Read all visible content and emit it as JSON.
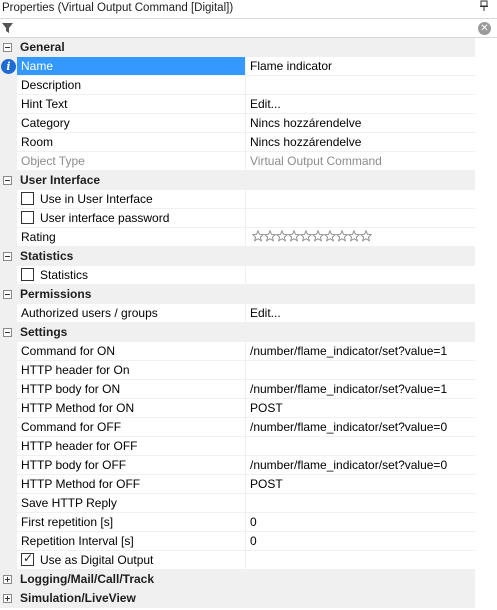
{
  "panel": {
    "title": "Properties (Virtual Output Command [Digital])",
    "pin_glyph": "📌",
    "filter_placeholder": "",
    "clear_glyph": "✕"
  },
  "rows": [
    {
      "kind": "category",
      "label": "General",
      "expanded": true
    },
    {
      "kind": "prop",
      "name": "Name",
      "value": "Flame indicator",
      "selected": true,
      "icon": "info-icon"
    },
    {
      "kind": "prop",
      "name": "Description",
      "value": ""
    },
    {
      "kind": "prop",
      "name": "Hint Text",
      "value": "Edit..."
    },
    {
      "kind": "prop",
      "name": "Category",
      "value": "Nincs hozzárendelve"
    },
    {
      "kind": "prop",
      "name": "Room",
      "value": "Nincs hozzárendelve"
    },
    {
      "kind": "prop",
      "name": "Object Type",
      "value": "Virtual Output Command",
      "readonly": true
    },
    {
      "kind": "category",
      "label": "User Interface",
      "expanded": true
    },
    {
      "kind": "check",
      "name": "Use in User Interface",
      "checked": false,
      "value": ""
    },
    {
      "kind": "check",
      "name": "User interface password",
      "checked": false,
      "value": ""
    },
    {
      "kind": "rating",
      "name": "Rating",
      "stars": 10,
      "rating": 0
    },
    {
      "kind": "category",
      "label": "Statistics",
      "expanded": true
    },
    {
      "kind": "check",
      "name": "Statistics",
      "checked": false,
      "value": ""
    },
    {
      "kind": "category",
      "label": "Permissions",
      "expanded": true
    },
    {
      "kind": "prop",
      "name": "Authorized users / groups",
      "value": "Edit..."
    },
    {
      "kind": "category",
      "label": "Settings",
      "expanded": true
    },
    {
      "kind": "prop",
      "name": "Command for ON",
      "value": "/number/flame_indicator/set?value=1"
    },
    {
      "kind": "prop",
      "name": "HTTP header for On",
      "value": ""
    },
    {
      "kind": "prop",
      "name": "HTTP body for ON",
      "value": "/number/flame_indicator/set?value=1"
    },
    {
      "kind": "prop",
      "name": "HTTP Method for ON",
      "value": "POST"
    },
    {
      "kind": "prop",
      "name": "Command for OFF",
      "value": "/number/flame_indicator/set?value=0"
    },
    {
      "kind": "prop",
      "name": "HTTP header for OFF",
      "value": ""
    },
    {
      "kind": "prop",
      "name": "HTTP body for OFF",
      "value": "/number/flame_indicator/set?value=0"
    },
    {
      "kind": "prop",
      "name": "HTTP Method for OFF",
      "value": "POST"
    },
    {
      "kind": "prop",
      "name": "Save HTTP Reply",
      "value": ""
    },
    {
      "kind": "prop",
      "name": "First repetition [s]",
      "value": "0"
    },
    {
      "kind": "prop",
      "name": "Repetition Interval [s]",
      "value": "0"
    },
    {
      "kind": "check",
      "name": "Use as Digital Output",
      "checked": true,
      "value": ""
    },
    {
      "kind": "category",
      "label": "Logging/Mail/Call/Track",
      "expanded": false
    },
    {
      "kind": "category",
      "label": "Simulation/LiveView",
      "expanded": false
    }
  ],
  "colors": {
    "selection": "#3399ff",
    "category_bg": "#f0f0f0",
    "info": "#1e6bd6",
    "readonly_text": "#8c8c8c",
    "star_stroke": "#8a8a8a"
  }
}
